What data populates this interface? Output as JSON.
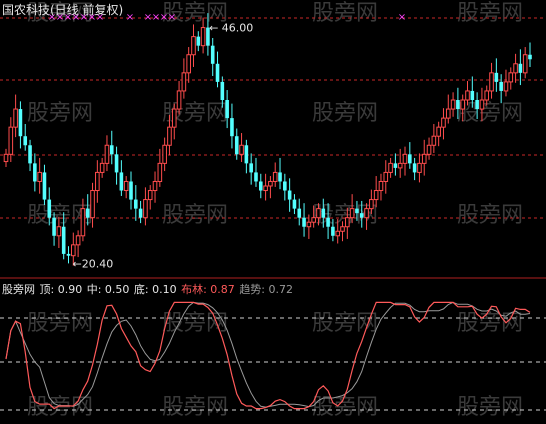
{
  "main_panel": {
    "title": "国农科技(日线 前复权)",
    "high_label": "46.00",
    "low_label": "20.40"
  },
  "indicator_panel": {
    "name": "股旁网",
    "top_label": "顶: 0.90",
    "mid_label": "中: 0.50",
    "bottom_label": "底: 0.10",
    "boll_label": "布林: 0.87",
    "trend_label": "趋势: 0.72"
  },
  "watermark": "股旁网",
  "colors": {
    "background": "#000000",
    "up": "#ff4d4d",
    "down": "#54ffff",
    "grid": "#c82828",
    "line_main": "#ff5a5a",
    "line_trend": "#9a9a9a",
    "marker": "#ff44ff",
    "text": "#e6e6e6"
  },
  "chart_data": {
    "type": "candlestick",
    "price_range": [
      19.0,
      47.5
    ],
    "high": 46.0,
    "low": 20.4,
    "closes": [
      32,
      35,
      37,
      34,
      33,
      31,
      29,
      30,
      27,
      25,
      23,
      24,
      21,
      20.8,
      22,
      23,
      26,
      25,
      28,
      30,
      31,
      33,
      32,
      30,
      28,
      29,
      27,
      26,
      25,
      27,
      28,
      29,
      31,
      33,
      35,
      37,
      39,
      41,
      43,
      45,
      44,
      46,
      44,
      42,
      40,
      38,
      36,
      34,
      32,
      33,
      31,
      30,
      29,
      28,
      28.5,
      29,
      30,
      29,
      28,
      27,
      26,
      25,
      24,
      24.5,
      25,
      26,
      25,
      24,
      23,
      23.5,
      24,
      25,
      26,
      25.5,
      25,
      26,
      27,
      28,
      29,
      30,
      31,
      30.5,
      31,
      32,
      31,
      30,
      31,
      32,
      33,
      34,
      35,
      36,
      37,
      38,
      37,
      38,
      39,
      38,
      37,
      38,
      39,
      41,
      40,
      39,
      40,
      41,
      42,
      41,
      43,
      42.5
    ],
    "indicator": {
      "top": 0.9,
      "mid": 0.5,
      "bottom": 0.1,
      "boll": 0.87,
      "trend": 0.72
    }
  }
}
